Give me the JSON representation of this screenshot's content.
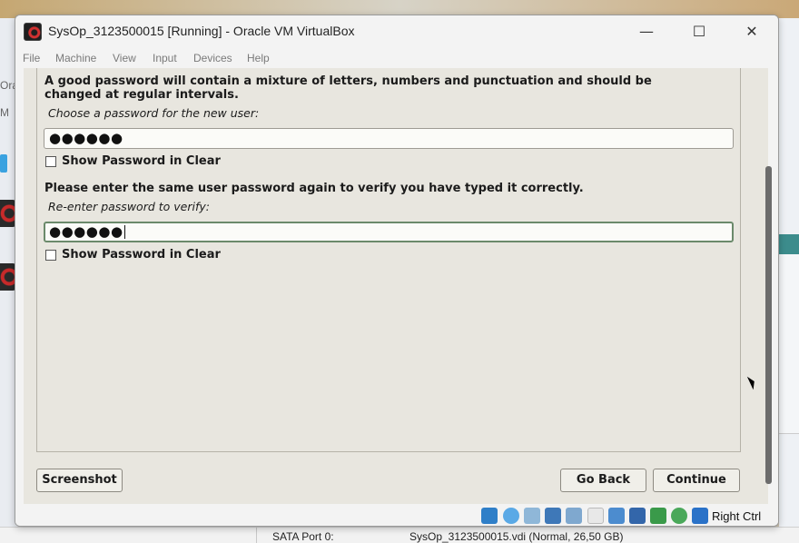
{
  "window": {
    "title": "SysOp_3123500015 [Running] - Oracle VM VirtualBox",
    "minimize_glyph": "—",
    "maximize_glyph": "☐",
    "close_glyph": "✕"
  },
  "menu": [
    "File",
    "Machine",
    "View",
    "Input",
    "Devices",
    "Help"
  ],
  "installer": {
    "intro": "A good password will contain a mixture of letters, numbers and punctuation and should be changed at regular intervals.",
    "choose_label": "Choose a password for the new user:",
    "password_value": "●●●●●●",
    "show_password_1": "Show Password in Clear",
    "verify_instruction": "Please enter the same user password again to verify you have typed it correctly.",
    "reenter_label": "Re-enter password to verify:",
    "verify_value": "●●●●●●",
    "show_password_2": "Show Password in Clear",
    "screenshot_button": "Screenshot",
    "go_back_button": "Go Back",
    "continue_button": "Continue"
  },
  "statusbar": {
    "host_key_label": "Right Ctrl",
    "icons": [
      "hard-disk-icon",
      "optical-drive-icon",
      "audio-icon",
      "network-icon",
      "usb-icon",
      "shared-folders-icon",
      "display-icon",
      "recording-icon",
      "cpu-icon",
      "mouse-integration-icon",
      "keyboard-icon",
      "download-icon"
    ]
  },
  "background": {
    "sata_label": "SATA Port 0:",
    "sata_value": "SysOp_3123500015.vdi (Normal, 26,50 GB)",
    "left_fragment_1": "Ora",
    "left_fragment_2": "M"
  },
  "colors": {
    "installer_bg": "#e8e6df",
    "window_chrome": "#f3f3f3",
    "accent_blue": "#3aa2e0",
    "focus_border": "#6b8a6b"
  }
}
